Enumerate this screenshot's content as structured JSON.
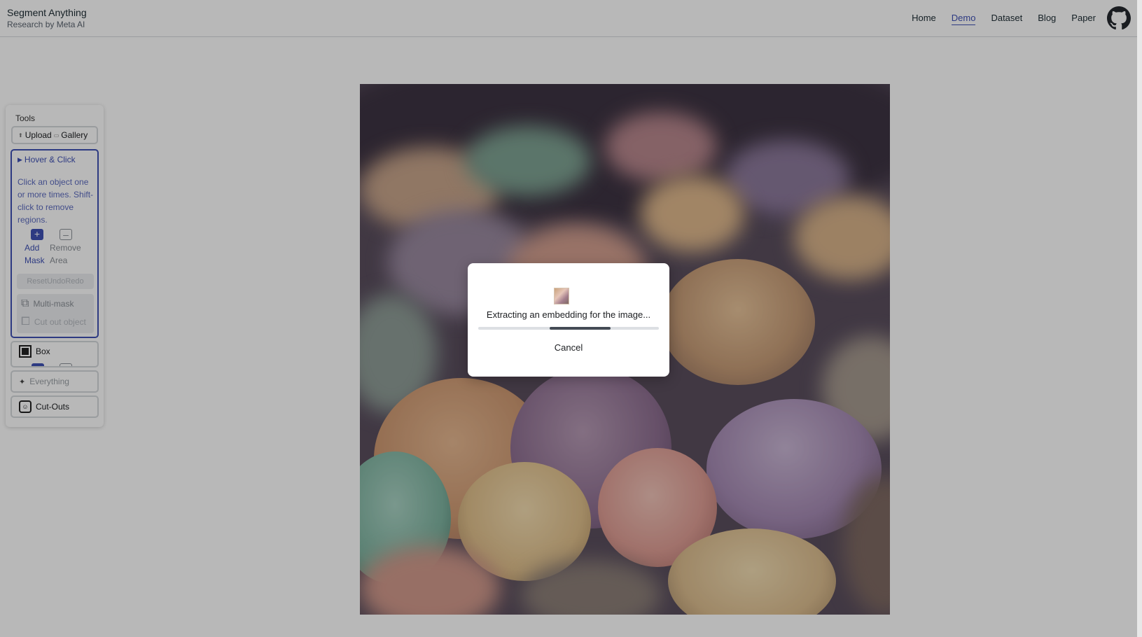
{
  "header": {
    "title": "Segment Anything",
    "subtitle": "Research by Meta AI",
    "nav": [
      {
        "label": "Home",
        "active": false
      },
      {
        "label": "Demo",
        "active": true
      },
      {
        "label": "Dataset",
        "active": false
      },
      {
        "label": "Blog",
        "active": false
      },
      {
        "label": "Paper",
        "active": false
      }
    ],
    "github_icon": "github-icon"
  },
  "sidebar": {
    "tools_label": "Tools",
    "upload_label": "Upload",
    "gallery_label": "Gallery",
    "hover_click": {
      "title": "Hover & Click",
      "description": "Click an object one or more times. Shift-click to remove regions.",
      "add_label_1": "Add",
      "add_label_2": "Mask",
      "remove_label_1": "Remove",
      "remove_label_2": "Area",
      "reset_undo_redo": "ResetUndoRedo",
      "multi_mask": "Multi-mask",
      "cut_out": "Cut out object"
    },
    "box_label": "Box",
    "everything_label": "Everything",
    "cutouts_label": "Cut-Outs"
  },
  "modal": {
    "message": "Extracting an embedding for the image...",
    "cancel_label": "Cancel",
    "progress": 0.34
  },
  "colors": {
    "accent": "#3f51b5",
    "overlay": "rgba(0,0,0,0.28)"
  }
}
